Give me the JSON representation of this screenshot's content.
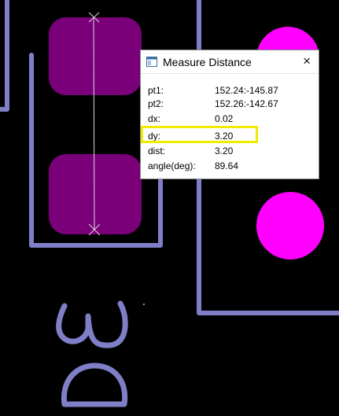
{
  "dialog": {
    "title": "Measure Distance",
    "close_glyph": "×",
    "rows": [
      {
        "label": "pt1:",
        "value": "152.24:-145.87"
      },
      {
        "label": "pt2:",
        "value": "152.26:-142.67"
      },
      {
        "label": "dx:",
        "value": "0.02"
      },
      {
        "label": "dy:",
        "value": "3.20",
        "highlighted": true
      },
      {
        "label": "dist:",
        "value": "3.20"
      },
      {
        "label": "angle(deg):",
        "value": "89.64"
      }
    ]
  },
  "board": {
    "designator": "D3",
    "colors": {
      "background": "#000000",
      "pad": "#7a007a",
      "trace": "#7f7fc8",
      "via": "#ff00ff",
      "measure_line": "#d8d8d8",
      "highlight": "#f2ea00"
    }
  },
  "icons": {
    "window_icon": "window-icon",
    "close_icon": "close-icon"
  }
}
